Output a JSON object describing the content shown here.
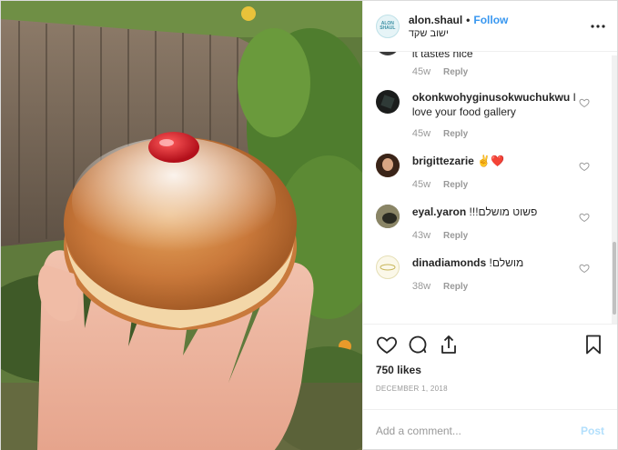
{
  "header": {
    "username": "alon.shaul",
    "separator": "•",
    "follow_label": "Follow",
    "location": "ישוב שקד",
    "avatar_text": "ALON SHAUL",
    "more_icon": "more-horizontal-icon"
  },
  "comments": [
    {
      "username": "",
      "text": "it tastes nice",
      "age": "45w",
      "reply": "Reply",
      "has_heart": false
    },
    {
      "username": "okonkwohyginusokwuchukwu",
      "text": "I love your food gallery",
      "age": "45w",
      "reply": "Reply",
      "has_heart": true
    },
    {
      "username": "brigittezarie",
      "text": "✌️❤️",
      "age": "45w",
      "reply": "Reply",
      "has_heart": true
    },
    {
      "username": "eyal.yaron",
      "text": "פשוט מושלם!!!",
      "age": "43w",
      "reply": "Reply",
      "has_heart": true
    },
    {
      "username": "dinadiamonds",
      "text": "מושלם!",
      "age": "38w",
      "reply": "Reply",
      "has_heart": true
    }
  ],
  "actions": {
    "like_icon": "heart-icon",
    "comment_icon": "comment-icon",
    "share_icon": "share-icon",
    "save_icon": "bookmark-icon"
  },
  "likes": "750 likes",
  "date": "DECEMBER 1, 2018",
  "add_comment": {
    "placeholder": "Add a comment...",
    "value": "",
    "post_label": "Post"
  },
  "colors": {
    "link_blue": "#3897f0",
    "post_disabled": "#b2dffc",
    "meta_gray": "#999999",
    "border": "#efefef"
  }
}
